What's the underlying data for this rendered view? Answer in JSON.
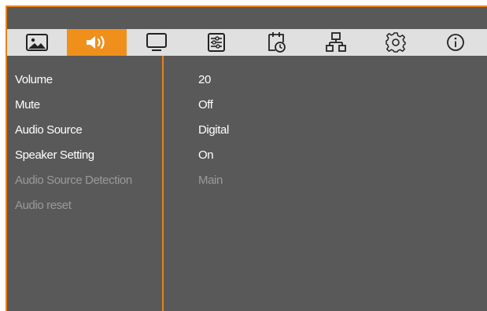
{
  "colors": {
    "accent": "#f0901c",
    "background": "#595959",
    "tab_bar": "#e0e0e0",
    "text": "#ffffff",
    "disabled_text": "#9a9a9a"
  },
  "tabs": [
    {
      "icon": "picture-icon",
      "active": false
    },
    {
      "icon": "speaker-icon",
      "active": true
    },
    {
      "icon": "monitor-icon",
      "active": false
    },
    {
      "icon": "sliders-icon",
      "active": false
    },
    {
      "icon": "calendar-clock-icon",
      "active": false
    },
    {
      "icon": "network-icon",
      "active": false
    },
    {
      "icon": "gear-icon",
      "active": false
    },
    {
      "icon": "info-icon",
      "active": false
    }
  ],
  "menu": [
    {
      "label": "Volume",
      "value": "20",
      "enabled": true
    },
    {
      "label": "Mute",
      "value": "Off",
      "enabled": true
    },
    {
      "label": "Audio Source",
      "value": "Digital",
      "enabled": true
    },
    {
      "label": "Speaker Setting",
      "value": "On",
      "enabled": true
    },
    {
      "label": "Audio Source Detection",
      "value": "Main",
      "enabled": false
    },
    {
      "label": "Audio reset",
      "value": "",
      "enabled": false
    }
  ]
}
